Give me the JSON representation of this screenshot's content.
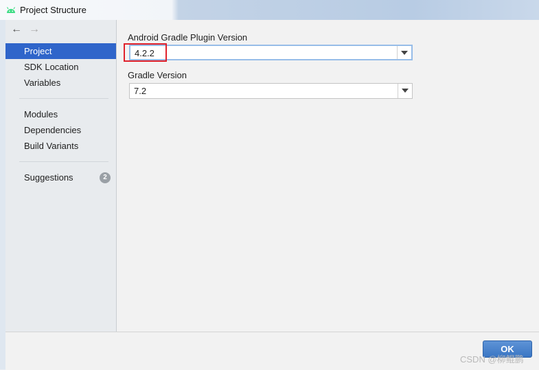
{
  "window": {
    "title": "Project Structure",
    "app_icon": "android-icon"
  },
  "navigation": {
    "back_icon": "arrow-left-icon",
    "forward_icon": "arrow-right-icon",
    "back_glyph": "←",
    "forward_glyph": "→"
  },
  "sidebar": {
    "groups": [
      {
        "items": [
          {
            "label": "Project",
            "selected": true
          },
          {
            "label": "SDK Location"
          },
          {
            "label": "Variables"
          }
        ]
      },
      {
        "items": [
          {
            "label": "Modules"
          },
          {
            "label": "Dependencies"
          },
          {
            "label": "Build Variants"
          }
        ]
      },
      {
        "items": [
          {
            "label": "Suggestions",
            "badge": "2"
          }
        ]
      }
    ]
  },
  "main": {
    "plugin_version": {
      "label": "Android Gradle Plugin Version",
      "value": "4.2.2"
    },
    "gradle_version": {
      "label": "Gradle Version",
      "value": "7.2"
    }
  },
  "footer": {
    "ok_label": "OK"
  },
  "watermark": "CSDN @柳鲲鹏",
  "colors": {
    "selection": "#2f65ca",
    "highlight_box": "#e0212b",
    "ok_button": "#3a76c4"
  }
}
